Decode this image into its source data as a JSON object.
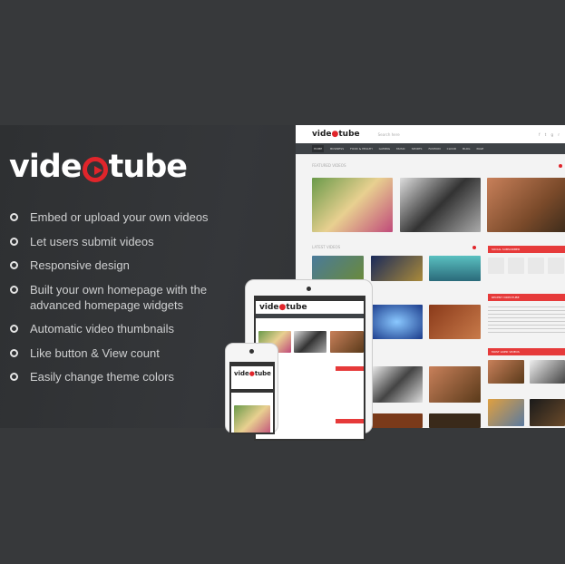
{
  "brand": {
    "logo_text_left": "vide",
    "logo_text_right": "tube",
    "accent": "#e0252b"
  },
  "features": [
    "Embed or upload your own videos",
    "Let users submit videos",
    "Responsive design",
    "Built your own homepage with the advanced homepage widgets",
    "Automatic video thumbnails",
    "Like button & View count",
    "Easily change theme colors"
  ],
  "mockup": {
    "search_placeholder": "Search here",
    "nav": [
      "HOME",
      "BUSINESS",
      "FOOD & HEALTH",
      "GAMING",
      "MUSIC",
      "SPORTS",
      "FASHION",
      "CLOUD",
      "BLOG",
      "PAGE"
    ],
    "featured_label": "FEATURED VIDEOS",
    "latest_label": "LATEST VIDEOS",
    "sidebar": [
      "SOCIAL SUBSCRIBER",
      "RECENT VIDEOTUBE",
      "MOST LIKED VIDEOS"
    ]
  }
}
